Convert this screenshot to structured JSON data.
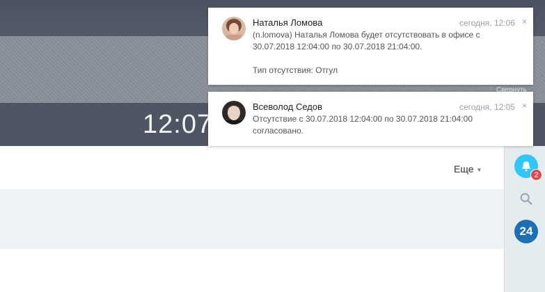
{
  "header": {
    "clock": "12:07",
    "collapse_label": "Свернуть"
  },
  "toolbar": {
    "more_label": "Еще"
  },
  "right_rail": {
    "notification_count": "2",
    "b24_label": "24",
    "colors": {
      "bell": "#2fc7f7",
      "badge": "#e9434e",
      "b24": "#1c6fb5"
    }
  },
  "notifications": [
    {
      "author": "Наталья Ломова",
      "time": "сегодня, 12:06",
      "close": "×",
      "line1": "(n.lomova) Наталья Ломова будет отсутствовать в офисе с",
      "line2": "30.07.2018 12:04:00 по 30.07.2018 21:04:00.",
      "line3": "Тип отсутствия: Отгул"
    },
    {
      "author": "Всеволод Седов",
      "time": "сегодня, 12:05",
      "close": "×",
      "line1": "Отсутствие с 30.07.2018 12:04:00 по 30.07.2018 21:04:00",
      "line2": "согласовано."
    }
  ]
}
